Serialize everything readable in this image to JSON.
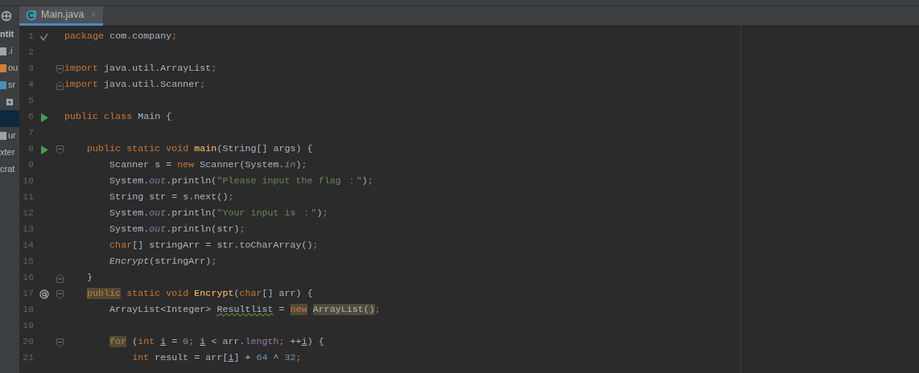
{
  "project_panel": {
    "items": [
      {
        "label": "ntit",
        "bold": true,
        "selected": false
      },
      {
        "label": ".i",
        "kind": "file",
        "bold": false,
        "selected": false
      },
      {
        "label": "ou",
        "kind": "folder-orange",
        "bold": false,
        "selected": false
      },
      {
        "label": "sr",
        "kind": "folder-blue",
        "bold": false,
        "selected": false
      },
      {
        "kind": "package",
        "selected": false
      },
      {
        "selected": true
      },
      {
        "label": "ur",
        "kind": "module",
        "bold": false,
        "selected": false
      },
      {
        "label": "xter",
        "bold": false,
        "selected": false
      },
      {
        "label": "crat",
        "bold": false,
        "selected": false
      }
    ]
  },
  "tabs": [
    {
      "label": "Main.java",
      "close": "×",
      "selected": true
    }
  ],
  "editor": {
    "lines": [
      {
        "number": "1",
        "gutter_icon": {
          "kind": "check"
        },
        "segments": [
          {
            "kind": "kw",
            "text": "package"
          },
          {
            "kind": "plain",
            "text": " com.company"
          },
          {
            "kind": "kw",
            "text": ";"
          }
        ]
      },
      {
        "number": "2"
      },
      {
        "number": "3",
        "fold_marker": {
          "kind": "start"
        },
        "segments": [
          {
            "kind": "kw",
            "text": "import"
          },
          {
            "kind": "plain",
            "text": " java.util.ArrayList"
          },
          {
            "kind": "kw",
            "text": ";"
          }
        ]
      },
      {
        "number": "4",
        "fold_marker": {
          "kind": "end"
        },
        "segments": [
          {
            "kind": "kw",
            "text": "import"
          },
          {
            "kind": "plain",
            "text": " java.util.Scanner"
          },
          {
            "kind": "kw",
            "text": ";"
          }
        ]
      },
      {
        "number": "5"
      },
      {
        "number": "6",
        "gutter_icon": {
          "kind": "run"
        },
        "segments": [
          {
            "kind": "kw",
            "text": "public class"
          },
          {
            "kind": "plain",
            "text": " Main {"
          }
        ]
      },
      {
        "number": "7"
      },
      {
        "number": "8",
        "gutter_icon": {
          "kind": "run"
        },
        "fold_marker": {
          "kind": "start"
        },
        "segments": [
          {
            "kind": "kw",
            "text": "    public static void "
          },
          {
            "kind": "decl",
            "text": "main"
          },
          {
            "kind": "plain",
            "text": "(String[] args) {"
          }
        ]
      },
      {
        "number": "9",
        "segments": [
          {
            "kind": "plain",
            "text": "        Scanner s = "
          },
          {
            "kind": "kw",
            "text": "new"
          },
          {
            "kind": "plain",
            "text": " Scanner(System."
          },
          {
            "kind": "field",
            "text": "in"
          },
          {
            "kind": "plain",
            "text": ")"
          },
          {
            "kind": "kw",
            "text": ";"
          }
        ]
      },
      {
        "number": "10",
        "segments": [
          {
            "kind": "plain",
            "text": "        System."
          },
          {
            "kind": "field",
            "text": "out"
          },
          {
            "kind": "plain",
            "text": ".println("
          },
          {
            "kind": "str",
            "text": "\"Please input the flag ：\""
          },
          {
            "kind": "plain",
            "text": ")"
          },
          {
            "kind": "kw",
            "text": ";"
          }
        ]
      },
      {
        "number": "11",
        "segments": [
          {
            "kind": "plain",
            "text": "        String str = s.next()"
          },
          {
            "kind": "kw",
            "text": ";"
          }
        ]
      },
      {
        "number": "12",
        "segments": [
          {
            "kind": "plain",
            "text": "        System."
          },
          {
            "kind": "field",
            "text": "out"
          },
          {
            "kind": "plain",
            "text": ".println("
          },
          {
            "kind": "str",
            "text": "\"Your input is ：\""
          },
          {
            "kind": "plain",
            "text": ")"
          },
          {
            "kind": "kw",
            "text": ";"
          }
        ]
      },
      {
        "number": "13",
        "segments": [
          {
            "kind": "plain",
            "text": "        System."
          },
          {
            "kind": "field",
            "text": "out"
          },
          {
            "kind": "plain",
            "text": ".println(str)"
          },
          {
            "kind": "kw",
            "text": ";"
          }
        ]
      },
      {
        "number": "14",
        "segments": [
          {
            "kind": "kw",
            "text": "        char"
          },
          {
            "kind": "plain",
            "text": "[] stringArr = str.toCharArray()"
          },
          {
            "kind": "kw",
            "text": ";"
          }
        ]
      },
      {
        "number": "15",
        "segments": [
          {
            "kind": "static",
            "text": "        Encrypt"
          },
          {
            "kind": "plain",
            "text": "(stringArr)"
          },
          {
            "kind": "kw",
            "text": ";"
          }
        ]
      },
      {
        "number": "16",
        "fold_marker": {
          "kind": "end"
        },
        "segments": [
          {
            "kind": "plain",
            "text": "    }"
          }
        ]
      },
      {
        "number": "17",
        "gutter_icon": {
          "kind": "override"
        },
        "fold_marker": {
          "kind": "start"
        },
        "segments": [
          {
            "kind": "kw-hl",
            "text": "    public"
          },
          {
            "kind": "kw",
            "text": " static void "
          },
          {
            "kind": "decl",
            "text": "Encrypt"
          },
          {
            "kind": "plain",
            "text": "("
          },
          {
            "kind": "kw",
            "text": "char"
          },
          {
            "kind": "plain",
            "text": "[] arr) {"
          }
        ]
      },
      {
        "number": "18",
        "segments": [
          {
            "kind": "plain",
            "text": "        ArrayList<Integer> "
          },
          {
            "kind": "wavy",
            "text": "Resultlist"
          },
          {
            "kind": "plain",
            "text": " = "
          },
          {
            "kind": "kw-hl",
            "text": "new"
          },
          {
            "kind": "plain-hl",
            "text": " ArrayList()"
          },
          {
            "kind": "kw",
            "text": ";"
          }
        ]
      },
      {
        "number": "19"
      },
      {
        "number": "20",
        "fold_marker": {
          "kind": "start"
        },
        "segments": [
          {
            "kind": "kw-hl",
            "text": "        for"
          },
          {
            "kind": "plain",
            "text": " ("
          },
          {
            "kind": "kw",
            "text": "int "
          },
          {
            "kind": "var",
            "text": "i"
          },
          {
            "kind": "plain",
            "text": " = "
          },
          {
            "kind": "num",
            "text": "0"
          },
          {
            "kind": "kw",
            "text": "; "
          },
          {
            "kind": "var",
            "text": "i"
          },
          {
            "kind": "plain",
            "text": " < arr."
          },
          {
            "kind": "member",
            "text": "length"
          },
          {
            "kind": "kw",
            "text": ";"
          },
          {
            "kind": "plain",
            "text": " ++"
          },
          {
            "kind": "var",
            "text": "i"
          },
          {
            "kind": "plain",
            "text": ") {"
          }
        ]
      },
      {
        "number": "21",
        "segments": [
          {
            "kind": "kw",
            "text": "            int"
          },
          {
            "kind": "plain",
            "text": " result = arr["
          },
          {
            "kind": "var",
            "text": "i"
          },
          {
            "kind": "plain",
            "text": "] + "
          },
          {
            "kind": "num",
            "text": "64"
          },
          {
            "kind": "plain",
            "text": " ^ "
          },
          {
            "kind": "num",
            "text": "32"
          },
          {
            "kind": "kw",
            "text": ";"
          }
        ]
      }
    ]
  }
}
